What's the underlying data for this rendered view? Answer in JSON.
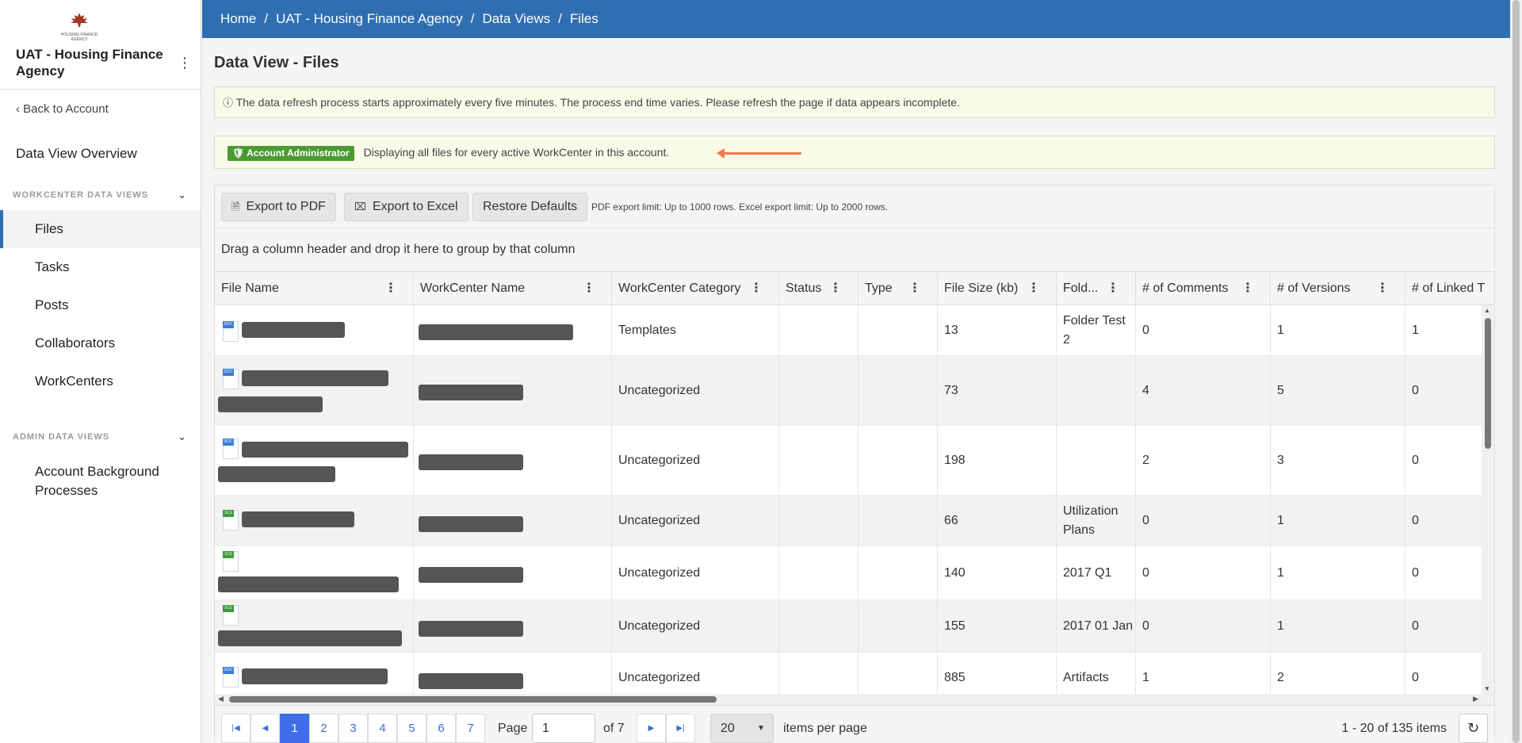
{
  "sidebar": {
    "logo_text": "HOUSING FINANCE AGENCY",
    "agency_name": "UAT - Housing Finance Agency",
    "back_link": "Back to Account",
    "overview": "Data View Overview",
    "workcenter_heading": "WORKCENTER DATA VIEWS",
    "workcenter_items": [
      "Files",
      "Tasks",
      "Posts",
      "Collaborators",
      "WorkCenters"
    ],
    "admin_heading": "ADMIN DATA VIEWS",
    "admin_items": [
      "Account Background Processes"
    ],
    "active_item": "Files"
  },
  "breadcrumb": [
    "Home",
    "UAT - Housing Finance Agency",
    "Data Views",
    "Files"
  ],
  "page_title": "Data View - Files",
  "notice_refresh": "The data refresh process starts approximately every five minutes. The process end time varies. Please refresh the page if data appears incomplete.",
  "notice_admin": {
    "badge": "Account Administrator",
    "text": "Displaying all files for every active WorkCenter in this account."
  },
  "toolbar": {
    "export_pdf": "Export to PDF",
    "export_excel": "Export to Excel",
    "restore": "Restore Defaults",
    "limit_note": "PDF export limit: Up to 1000 rows. Excel export limit: Up to 2000 rows."
  },
  "group_hint": "Drag a column header and drop it here to group by that column",
  "columns": [
    "File Name",
    "WorkCenter Name",
    "WorkCenter Category",
    "Status",
    "Type",
    "File Size (kb)",
    "Fold...",
    "# of Comments",
    "# of Versions",
    "# of Linked T"
  ],
  "rows": [
    {
      "icon": "doc",
      "category": "Templates",
      "status": "",
      "type": "",
      "size": "13",
      "folder": "Folder Test 2",
      "comments": "0",
      "versions": "1",
      "linked": "1"
    },
    {
      "icon": "doc",
      "category": "Uncategorized",
      "status": "",
      "type": "",
      "size": "73",
      "folder": "",
      "comments": "4",
      "versions": "5",
      "linked": "0"
    },
    {
      "icon": "doc",
      "category": "Uncategorized",
      "status": "",
      "type": "",
      "size": "198",
      "folder": "",
      "comments": "2",
      "versions": "3",
      "linked": "0"
    },
    {
      "icon": "xls",
      "category": "Uncategorized",
      "status": "",
      "type": "",
      "size": "66",
      "folder": "Utilization Plans",
      "comments": "0",
      "versions": "1",
      "linked": "0"
    },
    {
      "icon": "xls",
      "category": "Uncategorized",
      "status": "",
      "type": "",
      "size": "140",
      "folder": "2017 Q1",
      "comments": "0",
      "versions": "1",
      "linked": "0"
    },
    {
      "icon": "xls",
      "category": "Uncategorized",
      "status": "",
      "type": "",
      "size": "155",
      "folder": "2017 01 Jan",
      "comments": "0",
      "versions": "1",
      "linked": "0"
    },
    {
      "icon": "doc",
      "category": "Uncategorized",
      "status": "",
      "type": "",
      "size": "885",
      "folder": "Artifacts",
      "comments": "1",
      "versions": "2",
      "linked": "0"
    }
  ],
  "pager": {
    "pages": [
      "1",
      "2",
      "3",
      "4",
      "5",
      "6",
      "7"
    ],
    "current_page": "1",
    "page_label": "Page",
    "of_label": "of 7",
    "per_page": "20",
    "per_page_label": "items per page",
    "summary": "1 - 20 of 135 items"
  },
  "colors": {
    "topbar": "#2f6fb1",
    "active_page": "#3f6ee8",
    "badge": "#4a9a32",
    "arrow": "#f37a4b"
  }
}
